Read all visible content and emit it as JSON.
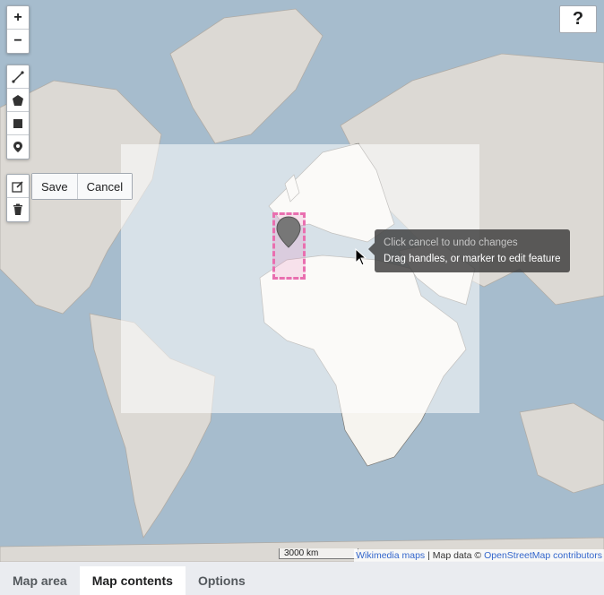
{
  "zoom": {
    "in_label": "+",
    "out_label": "−"
  },
  "help": {
    "label": "?"
  },
  "draw_tools": [
    "polyline-icon",
    "polygon-icon",
    "rectangle-icon",
    "marker-icon"
  ],
  "edit_tools": [
    "edit-icon",
    "trash-icon"
  ],
  "edit_actions": {
    "save_label": "Save",
    "cancel_label": "Cancel"
  },
  "tooltip": {
    "subtext": "Click cancel to undo changes",
    "text": "Drag handles, or marker to edit feature"
  },
  "scale": {
    "label": "3000 km"
  },
  "attribution": {
    "link1": "Wikimedia maps",
    "separator": " | Map data © ",
    "link2": "OpenStreetMap contributors"
  },
  "tabs": [
    {
      "label": "Map area",
      "active": false
    },
    {
      "label": "Map contents",
      "active": true
    },
    {
      "label": "Options",
      "active": false
    }
  ],
  "colors": {
    "water": "#a6bccd",
    "land": "#f6f4ef",
    "edit_accent": "#e96fb0"
  }
}
